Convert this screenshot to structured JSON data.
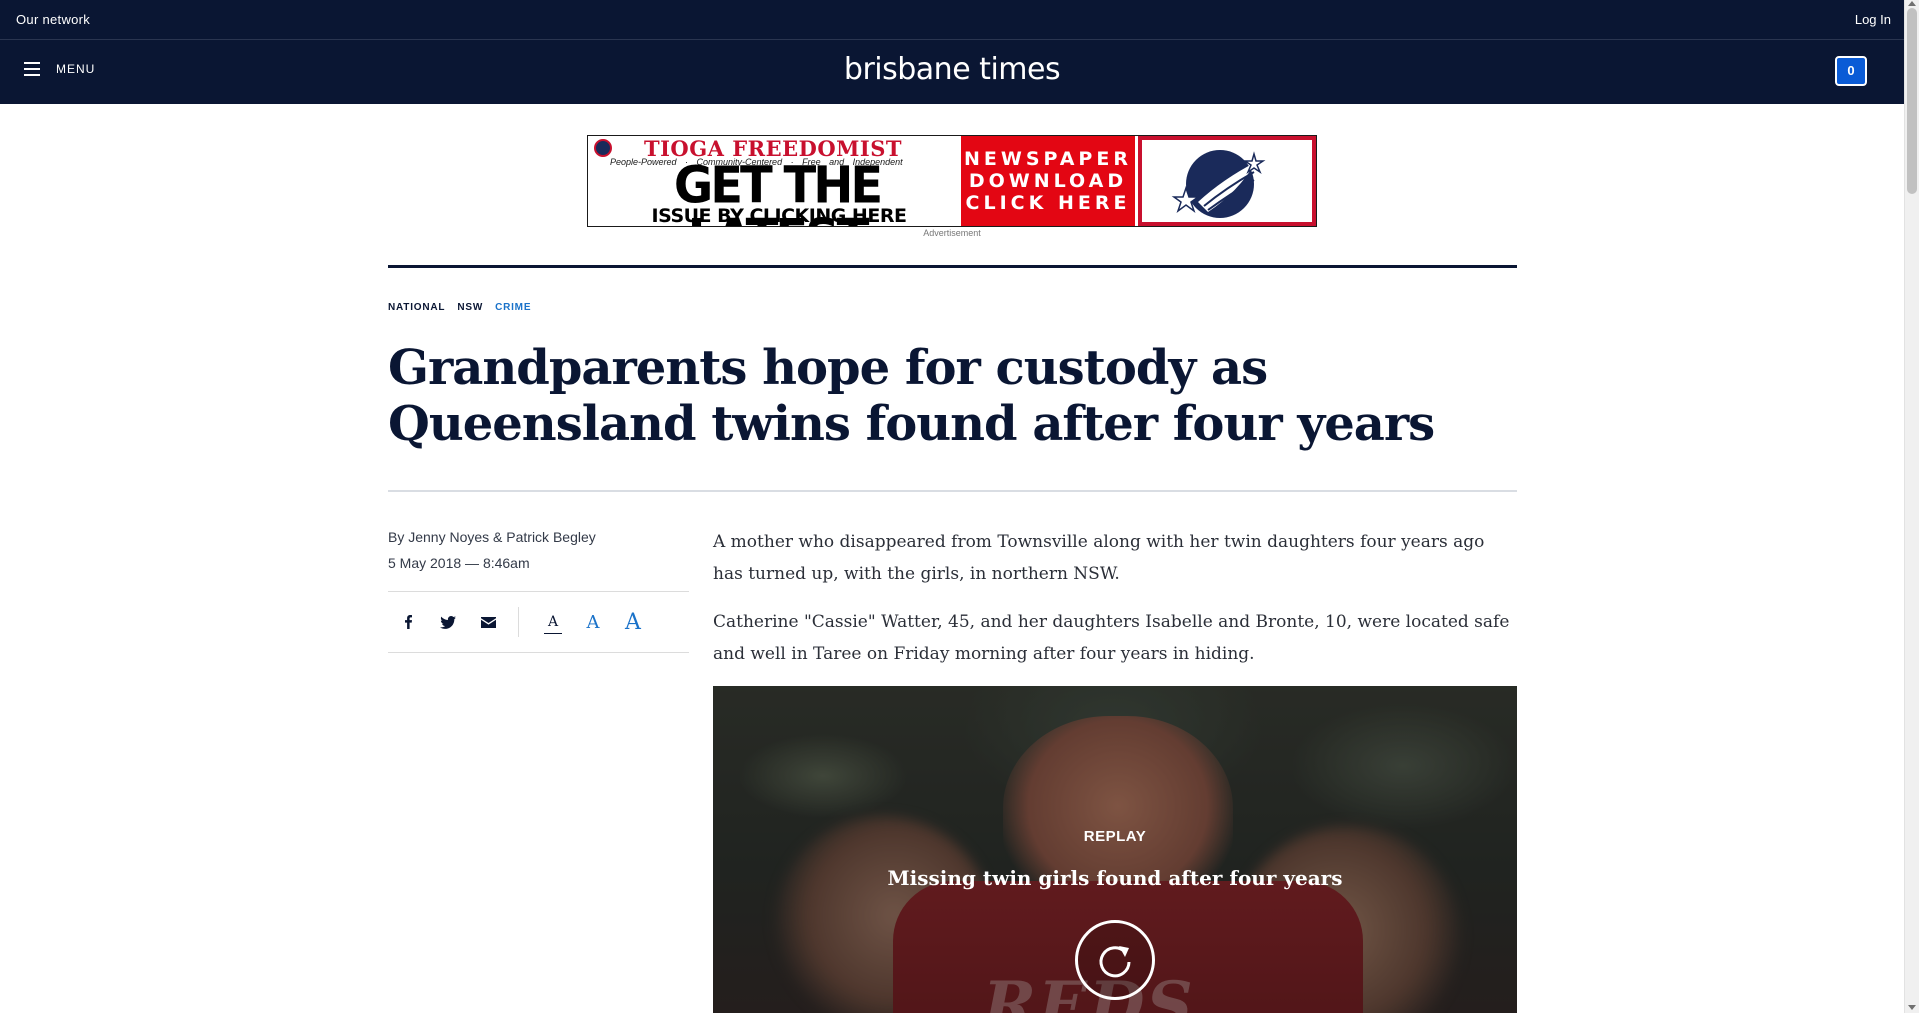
{
  "network_bar": {
    "our_network": "Our network",
    "login": "Log In"
  },
  "header": {
    "menu_label": "MENU",
    "logo": "brisbane times",
    "count": "0"
  },
  "advertisement": {
    "masthead": "TIOGA FREEDOMIST",
    "tagline": "People-Powered · Community-Centered · Free and Independent",
    "headline_line1": "GET THE LATEST",
    "headline_line2": "ISSUE BY CLICKING HERE",
    "cta_lines": [
      "NEWSPAPER",
      "DOWNLOAD",
      "CLICK HERE"
    ],
    "label": "Advertisement",
    "colors": {
      "red": "#e30613",
      "navy": "#1a2a5a"
    }
  },
  "article": {
    "breadcrumb": [
      "NATIONAL",
      "NSW",
      "CRIME"
    ],
    "headline": "Grandparents hope for custody as Queensland twins found after four years",
    "byline": "By Jenny Noyes & Patrick Begley",
    "date": "5 May 2018 — 8:46am",
    "paragraphs": [
      "A mother who disappeared from Townsville along with her twin daughters four years ago has turned up, with the girls, in northern NSW.",
      "Catherine \"Cassie\" Watter, 45, and her daughters Isabelle and Bronte, 10, were located safe and well in Taree on Friday morning after four years in hiding."
    ]
  },
  "share": {
    "icons": [
      "facebook-icon",
      "twitter-icon",
      "email-icon"
    ],
    "font_sizes": [
      "A",
      "A",
      "A"
    ]
  },
  "video": {
    "replay_label": "REPLAY",
    "title": "Missing twin girls found after four years",
    "shirt_text": "REDS"
  },
  "colors": {
    "navy": "#0a1633",
    "accent_blue": "#1a72c9",
    "badge_blue": "#0a5bd6"
  }
}
